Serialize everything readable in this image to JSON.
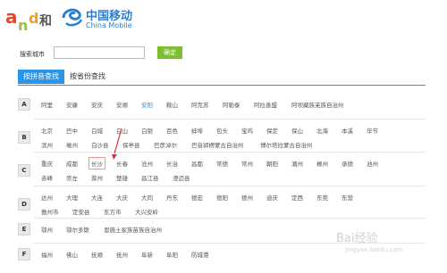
{
  "header": {
    "and_logo": "and和",
    "cm_title": "中国移动",
    "cm_sub": "China Mobile"
  },
  "search": {
    "label": "搜索城市",
    "input_value": "",
    "button": "确定"
  },
  "tabs": [
    {
      "label": "按拼音查找",
      "active": true
    },
    {
      "label": "按省份查找",
      "active": false
    }
  ],
  "groups": [
    {
      "letter": "A",
      "rows": [
        [
          "阿里",
          "安康",
          "安庆",
          "安顺",
          "安阳",
          "鞍山",
          "阿克苏",
          "阿勒泰",
          "阿拉善盟",
          "阿坝藏族羌族自治州"
        ]
      ]
    },
    {
      "letter": "B",
      "rows": [
        [
          "北京",
          "巴中",
          "白城",
          "白山",
          "白银",
          "百色",
          "蚌埠",
          "包头",
          "宝鸡",
          "保定",
          "保山",
          "北海",
          "本溪",
          "毕节"
        ],
        [
          "滨州",
          "亳州",
          "白沙县",
          "保亭县",
          "巴彦淖尔",
          "巴音郭楞蒙古自治州",
          "博尔塔拉蒙古自治州"
        ]
      ]
    },
    {
      "letter": "C",
      "rows": [
        [
          "重庆",
          "成都",
          "长沙",
          "长春",
          "沧州",
          "长治",
          "昌都",
          "常德",
          "常州",
          "朝阳",
          "潮州",
          "郴州",
          "承德",
          "池州"
        ],
        [
          "赤峰",
          "崇左",
          "滁州",
          "楚雄",
          "昌江县",
          "澄迈县"
        ]
      ]
    },
    {
      "letter": "D",
      "rows": [
        [
          "达州",
          "大理",
          "大连",
          "大庆",
          "大同",
          "丹东",
          "德宏",
          "德阳",
          "德州",
          "迪庆",
          "定西",
          "东莞",
          "东营"
        ],
        [
          "儋州市",
          "定安县",
          "东方市",
          "大兴安岭"
        ]
      ]
    },
    {
      "letter": "E",
      "rows": [
        [
          "鄂州",
          "鄂尔多斯",
          "恩施土家族苗族自治州"
        ]
      ]
    },
    {
      "letter": "F",
      "rows": [
        [
          "福州",
          "佛山",
          "抚顺",
          "抚州",
          "阜新",
          "阜阳",
          "防城港"
        ]
      ]
    }
  ],
  "watermark": "Bai经验",
  "watermark_sub": "jingyan.baidu.com",
  "colors": {
    "accent": "#2a95e6",
    "button": "#7cbf34",
    "highlight_border": "#e89999",
    "arrow": "#e03030"
  }
}
